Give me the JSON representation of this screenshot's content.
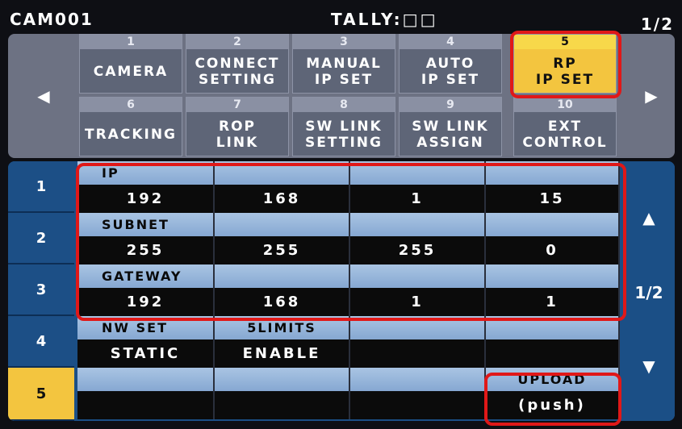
{
  "status": {
    "camera": "CAM001",
    "tally": "TALLY:□□",
    "page": "1/2"
  },
  "menu": {
    "items": [
      {
        "num": "1",
        "label": "CAMERA"
      },
      {
        "num": "2",
        "label": "CONNECT\nSETTING"
      },
      {
        "num": "3",
        "label": "MANUAL\nIP SET"
      },
      {
        "num": "4",
        "label": "AUTO\nIP SET"
      },
      {
        "num": "5",
        "label": "RP\nIP SET"
      },
      {
        "num": "6",
        "label": "TRACKING"
      },
      {
        "num": "7",
        "label": "ROP\nLINK"
      },
      {
        "num": "8",
        "label": "SW LINK\nSETTING"
      },
      {
        "num": "9",
        "label": "SW LINK\nASSIGN"
      },
      {
        "num": "10",
        "label": "EXT\nCONTROL"
      }
    ],
    "left_icon": "arrow-left-icon",
    "right_icon": "arrow-right-icon",
    "active_color": "#f3c53f"
  },
  "table": {
    "row_numbers": [
      "1",
      "2",
      "3",
      "4",
      "5"
    ],
    "rows": [
      {
        "headers": [
          "IP",
          "",
          "",
          ""
        ],
        "values": [
          "192",
          "168",
          "1",
          "15"
        ]
      },
      {
        "headers": [
          "SUBNET",
          "",
          "",
          ""
        ],
        "values": [
          "255",
          "255",
          "255",
          "0"
        ]
      },
      {
        "headers": [
          "GATEWAY",
          "",
          "",
          ""
        ],
        "values": [
          "192",
          "168",
          "1",
          "1"
        ]
      },
      {
        "headers": [
          "NW SET",
          "5LIMITS",
          "",
          ""
        ],
        "values": [
          "STATIC",
          "ENABLE",
          "",
          ""
        ]
      },
      {
        "headers": [
          "",
          "",
          "",
          "UPLOAD"
        ],
        "values": [
          "",
          "",
          "",
          "(push)"
        ]
      }
    ],
    "side_page": "1/2",
    "up_icon": "arrow-up-icon",
    "down_icon": "arrow-down-icon"
  }
}
